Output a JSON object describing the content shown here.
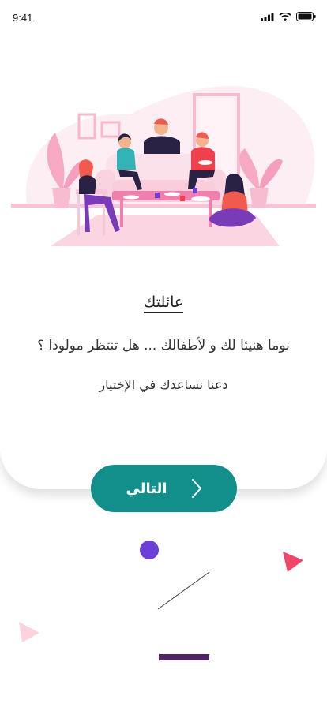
{
  "status_bar": {
    "time": "9:41"
  },
  "onboarding": {
    "title": "عائلتك",
    "description_line1": "نوما هنيئا لك و لأطفالك ... هل تنتظر مولودا ؟",
    "description_line2": "دعنا نساعدك في الإختيار"
  },
  "actions": {
    "next_label": "التالي"
  },
  "colors": {
    "primary": "#138f8b",
    "accent_purple": "#6b3fd8",
    "accent_pink": "#f2456a",
    "progress_bar": "#4f2663"
  },
  "icons": [
    "signal-icon",
    "wifi-icon",
    "battery-icon",
    "chevron-right-icon"
  ]
}
